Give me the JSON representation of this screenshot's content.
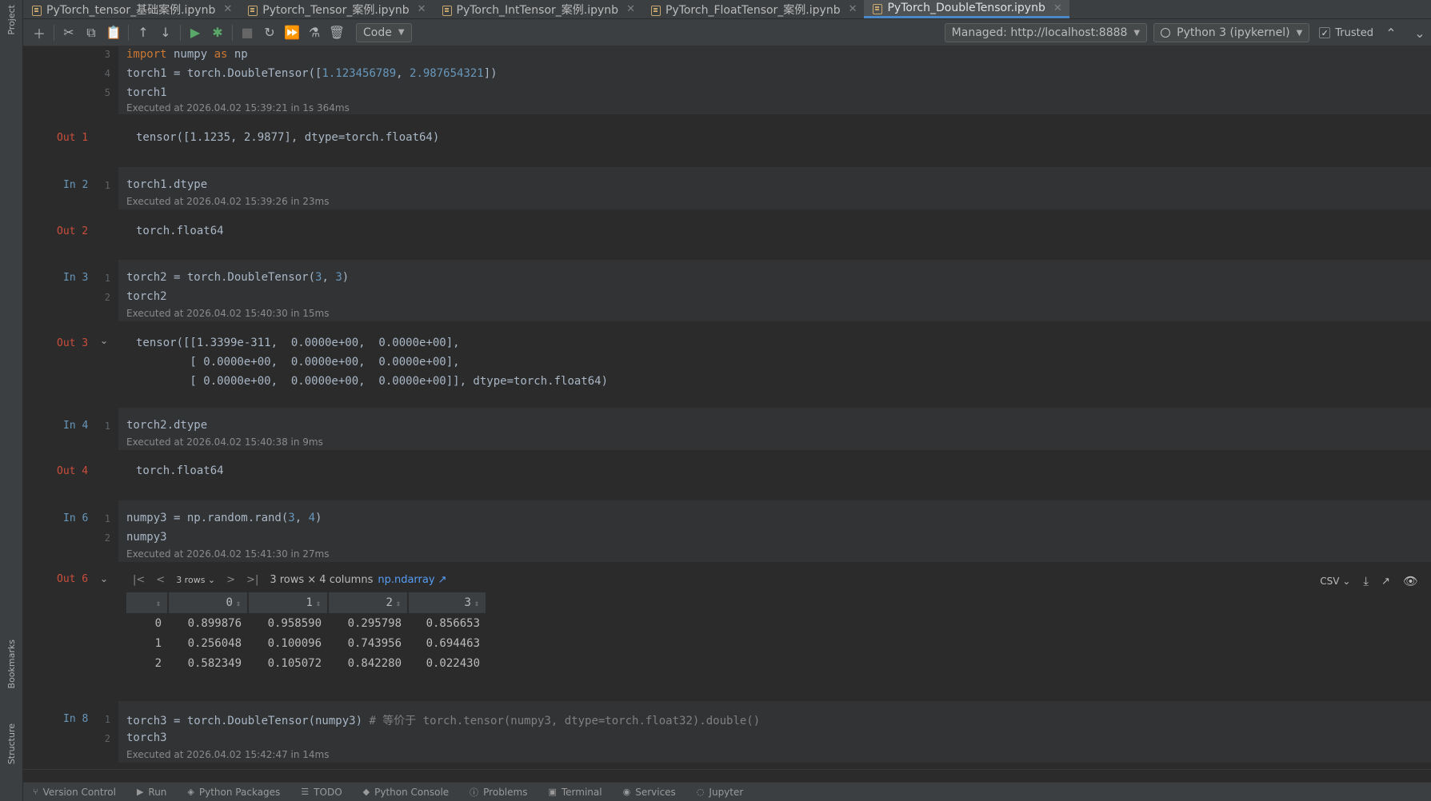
{
  "left_strip": {
    "project": "Project",
    "bookmarks": "Bookmarks",
    "structure": "Structure"
  },
  "tabs": [
    {
      "label": "PyTorch_tensor_基础案例.ipynb",
      "active": false
    },
    {
      "label": "Pytorch_Tensor_案例.ipynb",
      "active": false
    },
    {
      "label": "PyTorch_IntTensor_案例.ipynb",
      "active": false
    },
    {
      "label": "PyTorch_FloatTensor_案例.ipynb",
      "active": false
    },
    {
      "label": "PyTorch_DoubleTensor.ipynb",
      "active": true
    }
  ],
  "toolbar": {
    "cell_type": "Code",
    "server": "Managed: http://localhost:8888",
    "kernel": "Python 3 (ipykernel)",
    "trusted": "Trusted",
    "icons": [
      "add-icon",
      "cut-icon",
      "copy-icon",
      "paste-icon",
      "move-up-icon",
      "move-down-icon",
      "run-icon",
      "debug-icon",
      "stop-icon",
      "restart-icon",
      "run-all-icon",
      "clear-icon",
      "delete-icon"
    ]
  },
  "cells": {
    "c1": {
      "lines": [
        "3",
        "4",
        "5"
      ],
      "exec": "Executed at 2026.04.02 15:39:21 in 1s 364ms",
      "out_label": "Out 1",
      "out": "tensor([1.1235, 2.9877], dtype=torch.float64)",
      "code_l1_kw1": "import",
      "code_l1_a": " numpy ",
      "code_l1_kw2": "as",
      "code_l1_b": " np",
      "code_l2_a": "torch1 = torch.DoubleTensor([",
      "code_l2_n1": "1.123456789",
      "code_l2_c": ", ",
      "code_l2_n2": "2.987654321",
      "code_l2_d": "])",
      "code_l3": "torch1"
    },
    "c2": {
      "in_label": "In 2",
      "lines": [
        "1"
      ],
      "code": "torch1.dtype",
      "exec": "Executed at 2026.04.02 15:39:26 in 23ms",
      "out_label": "Out 2",
      "out": "torch.float64"
    },
    "c3": {
      "in_label": "In 3",
      "lines": [
        "1",
        "2"
      ],
      "code_l1_a": "torch2 = torch.DoubleTensor(",
      "code_l1_n1": "3",
      "code_l1_c": ", ",
      "code_l1_n2": "3",
      "code_l1_d": ")",
      "code_l2": "torch2",
      "exec": "Executed at 2026.04.02 15:40:30 in 15ms",
      "out_label": "Out 3",
      "out": "tensor([[1.3399e-311,  0.0000e+00,  0.0000e+00],\n        [ 0.0000e+00,  0.0000e+00,  0.0000e+00],\n        [ 0.0000e+00,  0.0000e+00,  0.0000e+00]], dtype=torch.float64)"
    },
    "c4": {
      "in_label": "In 4",
      "lines": [
        "1"
      ],
      "code": "torch2.dtype",
      "exec": "Executed at 2026.04.02 15:40:38 in 9ms",
      "out_label": "Out 4",
      "out": "torch.float64"
    },
    "c6": {
      "in_label": "In 6",
      "lines": [
        "1",
        "2"
      ],
      "code_l1_a": "numpy3 = np.random.rand(",
      "code_l1_n1": "3",
      "code_l1_c": ", ",
      "code_l1_n2": "4",
      "code_l1_d": ")",
      "code_l2": "numpy3",
      "exec": "Executed at 2026.04.02 15:41:30 in 27ms",
      "out_label": "Out 6"
    },
    "c8": {
      "in_label": "In 8",
      "lines": [
        "1",
        "2"
      ],
      "code_l1": "torch3 = torch.DoubleTensor(numpy3) ",
      "comment": "# 等价于 torch.tensor(numpy3, dtype=torch.float32).double()",
      "code_l2": "torch3",
      "exec": "Executed at 2026.04.02 15:42:47 in 14ms"
    }
  },
  "dataframe": {
    "rows_select": "3 rows",
    "summary": "3 rows × 4 columns",
    "type_link": "np.ndarray ↗",
    "export": "CSV",
    "columns": [
      "",
      "0",
      "1",
      "2",
      "3"
    ],
    "rows": [
      [
        "0",
        "0.899876",
        "0.958590",
        "0.295798",
        "0.856653"
      ],
      [
        "1",
        "0.256048",
        "0.100096",
        "0.743956",
        "0.694463"
      ],
      [
        "2",
        "0.582349",
        "0.105072",
        "0.842280",
        "0.022430"
      ]
    ]
  },
  "bottom_bar": [
    "Version Control",
    "Run",
    "Python Packages",
    "TODO",
    "Python Console",
    "Problems",
    "Terminal",
    "Services",
    "Jupyter"
  ]
}
